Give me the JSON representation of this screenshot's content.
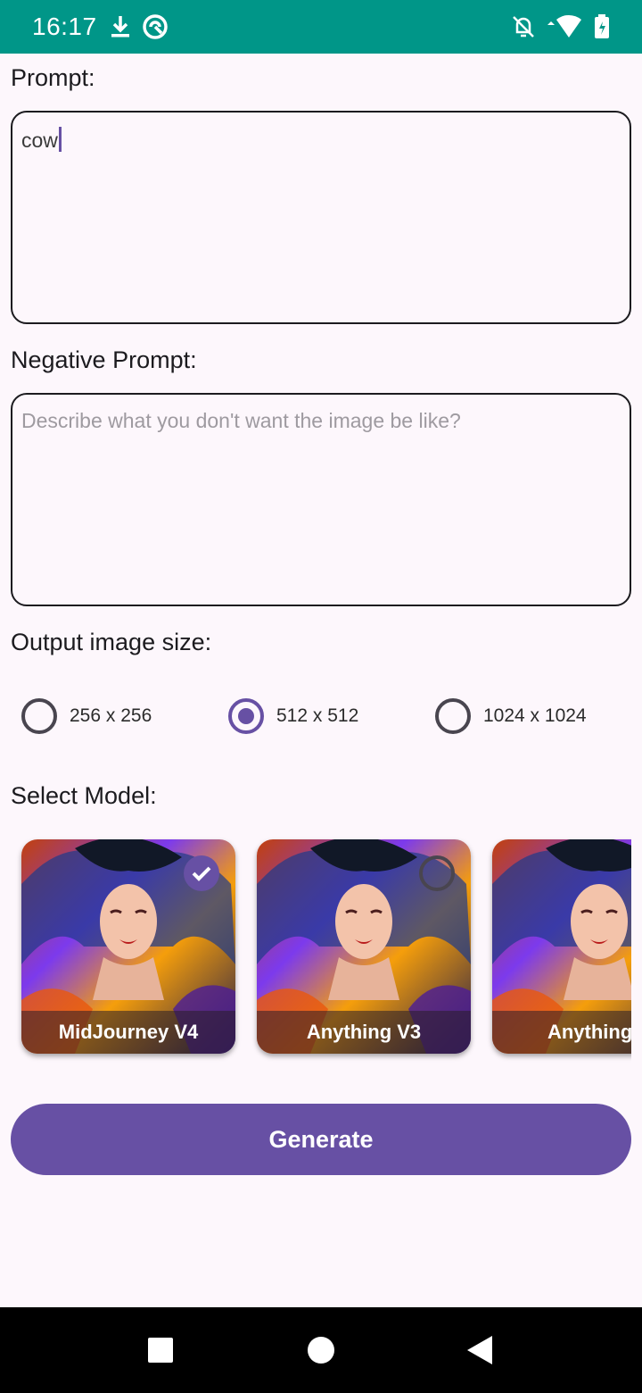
{
  "status_bar": {
    "time": "16:17",
    "left_icons": [
      "download-icon",
      "vpn-icon"
    ],
    "right_icons": [
      "notifications-off-icon",
      "wifi-icon",
      "battery-icon"
    ]
  },
  "form": {
    "prompt_label": "Prompt:",
    "prompt_value": "cow",
    "negative_label": "Negative Prompt:",
    "negative_value": "",
    "negative_placeholder": "Describe what you don't want the image be like?",
    "size_label": "Output image size:",
    "sizes": [
      {
        "label": "256 x 256",
        "selected": false
      },
      {
        "label": "512 x 512",
        "selected": true
      },
      {
        "label": "1024 x 1024",
        "selected": false
      }
    ],
    "model_label": "Select Model:",
    "models": [
      {
        "name": "MidJourney V4",
        "selected": true
      },
      {
        "name": "Anything V3",
        "selected": false
      },
      {
        "name": "Anything V",
        "selected": false
      }
    ],
    "generate_label": "Generate"
  },
  "colors": {
    "status_bar": "#009688",
    "accent": "#6750a4",
    "background": "#fdf7fc"
  },
  "nav_bar": {
    "buttons": [
      "recents-square-icon",
      "home-circle-icon",
      "back-triangle-icon"
    ]
  }
}
